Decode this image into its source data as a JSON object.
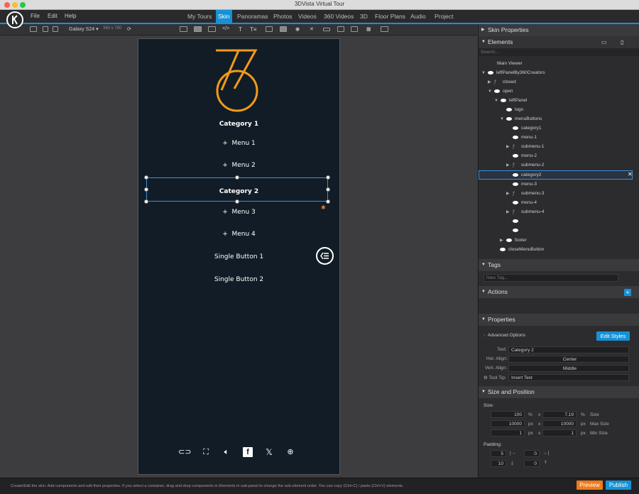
{
  "window": {
    "title": "3DVista Virtual Tour"
  },
  "menu": {
    "file": "File",
    "edit": "Edit",
    "help": "Help"
  },
  "nav_tabs": [
    {
      "label": "My Tours"
    },
    {
      "label": "Skin"
    },
    {
      "label": "Panoramas"
    },
    {
      "label": "Photos"
    },
    {
      "label": "Videos"
    },
    {
      "label": "360 Videos"
    },
    {
      "label": "3D"
    },
    {
      "label": "Floor Plans"
    },
    {
      "label": "Audio"
    },
    {
      "label": "Project"
    }
  ],
  "toolbar": {
    "device": "Galaxy S24",
    "resolution": "360 x 780",
    "text_tool": "T",
    "text_list_tool": "T≡"
  },
  "phone": {
    "logo_color": "#f29a1a",
    "rows": [
      {
        "label": "Category 1"
      },
      {
        "prefix": "+",
        "label": "Menu 1"
      },
      {
        "prefix": "+",
        "label": "Menu 2"
      },
      {
        "label": "Category 2"
      },
      {
        "prefix": "+",
        "label": "Menu 3"
      },
      {
        "prefix": "+",
        "label": "Menu 4"
      },
      {
        "label": "Single Button 1"
      },
      {
        "label": "Single Button 2"
      }
    ],
    "footer_icons": [
      "vr-icon",
      "fullscreen-icon",
      "volume-icon",
      "facebook-icon",
      "x-icon",
      "globe-icon"
    ]
  },
  "panel": {
    "skin_properties": "Skin Properties",
    "elements": "Elements",
    "search_placeholder": "Search...",
    "tree": [
      {
        "label": "Main Viewer"
      },
      {
        "label": "leftPanelBy360Creators"
      },
      {
        "label": "closed"
      },
      {
        "label": "open"
      },
      {
        "label": "leftPanel"
      },
      {
        "label": "logo"
      },
      {
        "label": "menuButtons"
      },
      {
        "label": "category1"
      },
      {
        "label": "menu-1"
      },
      {
        "label": "submenu-1"
      },
      {
        "label": "menu-2"
      },
      {
        "label": "submenu-2"
      },
      {
        "label": "category2"
      },
      {
        "label": "menu-3"
      },
      {
        "label": "submenu-3"
      },
      {
        "label": "menu-4"
      },
      {
        "label": "submenu-4"
      },
      {
        "label": ""
      },
      {
        "label": ""
      },
      {
        "label": "footer"
      },
      {
        "label": "closeMenuButton"
      }
    ],
    "tags": "Tags",
    "new_tag_placeholder": "New Tag...",
    "actions": "Actions",
    "properties": "Properties",
    "advanced_options": "Advanced Options",
    "edit_styles": "Edit Styles",
    "text_label": "Text:",
    "text_value": "Category 2",
    "hor_align_label": "Hor. Align:",
    "hor_align_value": "Center",
    "vert_align_label": "Vert. Align:",
    "vert_align_value": "Middle",
    "tooltip_label": "Tool Tip:",
    "tooltip_value": "Insert Text",
    "size_position": "Size and Position",
    "size_label": "Size:",
    "size": {
      "w": "100",
      "w_unit": "%",
      "h": "7.19",
      "h_unit": "%",
      "size": "Size",
      "max_w": "10000",
      "max_h": "10000",
      "max_unit": "px",
      "max_size": "Max Size",
      "min_w": "1",
      "min_h": "1",
      "min_unit": "px",
      "min_size": "Min Size",
      "x": "x"
    },
    "padding_label": "Padding:",
    "padding": {
      "right": "5",
      "left": "0",
      "bottom": "10",
      "top": "0"
    }
  },
  "status": {
    "message": "Create/Edit the skin. Add components and edit their properties. If you select a container, drag and drop components in Elements in sub-panel to change the sub-element order. You can copy (Ctrl+C) / paste (Ctrl+V) elements.",
    "preview": "Preview",
    "publish": "Publish"
  }
}
